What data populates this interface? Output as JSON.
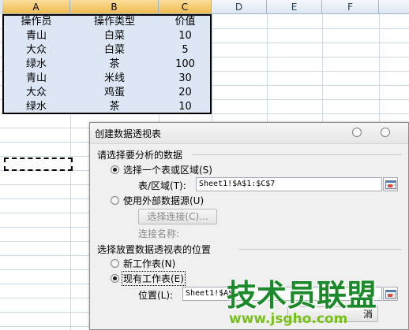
{
  "sheet": {
    "columns": [
      "A",
      "B",
      "C",
      "D",
      "E",
      "F"
    ],
    "rows": [
      [
        "操作员",
        "操作类型",
        "价值"
      ],
      [
        "青山",
        "白菜",
        "10"
      ],
      [
        "大众",
        "白菜",
        "5"
      ],
      [
        "绿水",
        "茶",
        "100"
      ],
      [
        "青山",
        "米线",
        "30"
      ],
      [
        "大众",
        "鸡蛋",
        "20"
      ],
      [
        "绿水",
        "茶",
        "10"
      ]
    ],
    "selection_fill": "#dce6f4"
  },
  "dialog": {
    "title": "创建数据透视表",
    "section1": "请选择要分析的数据",
    "opt_table": "选择一个表或区域(S)",
    "range_label": "表/区域(T):",
    "range_value": "Sheet1!$A$1:$C$7",
    "opt_external": "使用外部数据源(U)",
    "choose_conn": "选择连接(C)...",
    "conn_name": "连接名称:",
    "section2": "选择放置数据透视表的位置",
    "opt_new": "新工作表(N)",
    "opt_existing": "现有工作表(E)",
    "loc_label": "位置(L):",
    "loc_value": "Sheet1!$A$",
    "cancel_partial": "消",
    "selected_source": "opt_table",
    "selected_location": "opt_existing"
  },
  "watermark": {
    "logo_text": "技术员联盟",
    "url": "www.jsgho.com",
    "logo_color": "#1d8a2a",
    "url_color": "#7abf1e"
  }
}
